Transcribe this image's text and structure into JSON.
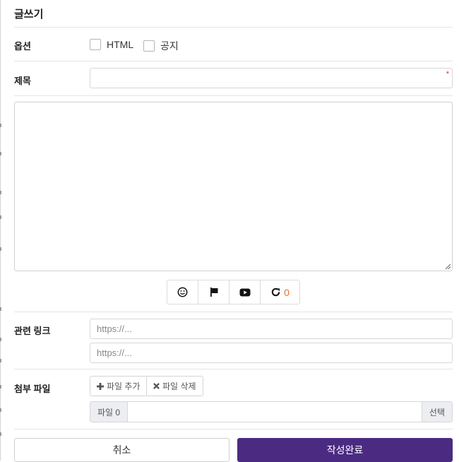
{
  "form": {
    "title": "글쓰기",
    "options_label": "옵션",
    "option_html": "HTML",
    "option_notice": "공지",
    "subject_label": "제목",
    "subject_value": "",
    "required_mark": "*",
    "content_value": "",
    "toolbar": {
      "autosave_count": "0"
    },
    "link_label": "관련 링크",
    "link_placeholder_1": "https://...",
    "link_placeholder_2": "https://...",
    "attach_label": "첨부 파일",
    "add_file_label": "파일 추가",
    "delete_file_label": "파일 삭제",
    "file_count_label": "파일 0",
    "select_label": "선택",
    "cancel_label": "취소",
    "submit_label": "작성완료"
  },
  "colors": {
    "submit_bg": "#4b2b82",
    "count_text": "#f06b2a",
    "required": "#e0352b"
  },
  "icons": [
    "smile-icon",
    "flag-icon",
    "video-play-icon",
    "refresh-icon",
    "plus-icon",
    "times-icon"
  ]
}
